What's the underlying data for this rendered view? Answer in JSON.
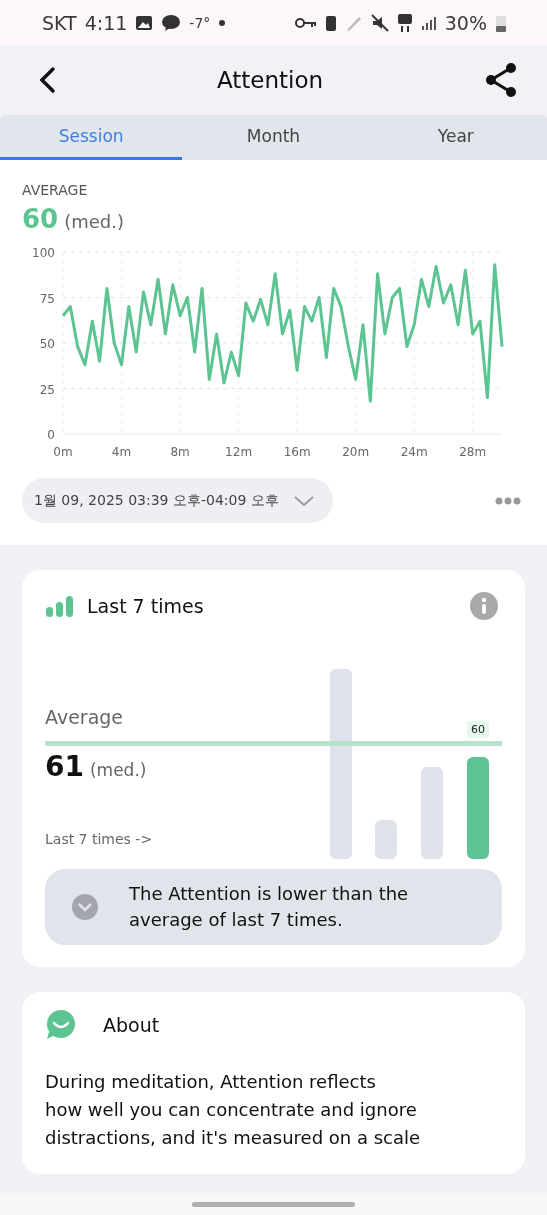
{
  "status_bar": {
    "carrier": "SKT",
    "time": "4:11",
    "temperature": "-7°",
    "battery": "30%"
  },
  "header": {
    "title": "Attention"
  },
  "tabs": [
    {
      "label": "Session",
      "selected": true
    },
    {
      "label": "Month",
      "selected": false
    },
    {
      "label": "Year",
      "selected": false
    }
  ],
  "summary": {
    "label": "AVERAGE",
    "value": "60",
    "unit": "(med.)"
  },
  "session_chart": {
    "chart_data": {
      "type": "line",
      "xlim": [
        0,
        30
      ],
      "ylim": [
        0,
        100
      ],
      "xticks": [
        {
          "value": 0,
          "label": "0m"
        },
        {
          "value": 4,
          "label": "4m"
        },
        {
          "value": 8,
          "label": "8m"
        },
        {
          "value": 12,
          "label": "12m"
        },
        {
          "value": 16,
          "label": "16m"
        },
        {
          "value": 20,
          "label": "20m"
        },
        {
          "value": 24,
          "label": "24m"
        },
        {
          "value": 28,
          "label": "28m"
        }
      ],
      "yticks": [
        0,
        25,
        50,
        75,
        100
      ],
      "grid": true,
      "x": [
        0,
        0.5,
        1,
        1.5,
        2,
        2.5,
        3,
        3.5,
        4,
        4.5,
        5,
        5.5,
        6,
        6.5,
        7,
        7.5,
        8,
        8.5,
        9,
        9.5,
        10,
        10.5,
        11,
        11.5,
        12,
        12.5,
        13,
        13.5,
        14,
        14.5,
        15,
        15.5,
        16,
        16.5,
        17,
        17.5,
        18,
        18.5,
        19,
        19.5,
        20,
        20.5,
        21,
        21.5,
        22,
        22.5,
        23,
        23.5,
        24,
        24.5,
        25,
        25.5,
        26,
        26.5,
        27,
        27.5,
        28,
        28.5,
        29,
        29.5,
        30
      ],
      "series": [
        {
          "color": "#5cc491",
          "values": [
            65,
            70,
            48,
            38,
            62,
            40,
            80,
            50,
            38,
            70,
            45,
            78,
            60,
            85,
            55,
            82,
            65,
            75,
            45,
            80,
            30,
            55,
            28,
            45,
            32,
            72,
            62,
            74,
            60,
            88,
            55,
            68,
            35,
            70,
            62,
            75,
            42,
            80,
            70,
            48,
            30,
            60,
            18,
            88,
            55,
            75,
            80,
            48,
            60,
            85,
            70,
            92,
            72,
            82,
            60,
            90,
            55,
            62,
            20,
            93,
            48
          ]
        }
      ]
    }
  },
  "date_range": {
    "label": "1월 09, 2025 03:39 오후-04:09 오후"
  },
  "last_times_card": {
    "title": "Last 7 times",
    "average_label": "Average",
    "average_value": "61",
    "average_unit": "(med.)",
    "link": "Last 7 times ->",
    "current_badge": "60",
    "insight": "The Attention is lower than the average of last 7 times."
  },
  "about_card": {
    "title": "About",
    "lines": [
      "During meditation, Attention reflects",
      "how well you can concentrate and ignore",
      "distractions, and it's measured on a scale"
    ]
  }
}
